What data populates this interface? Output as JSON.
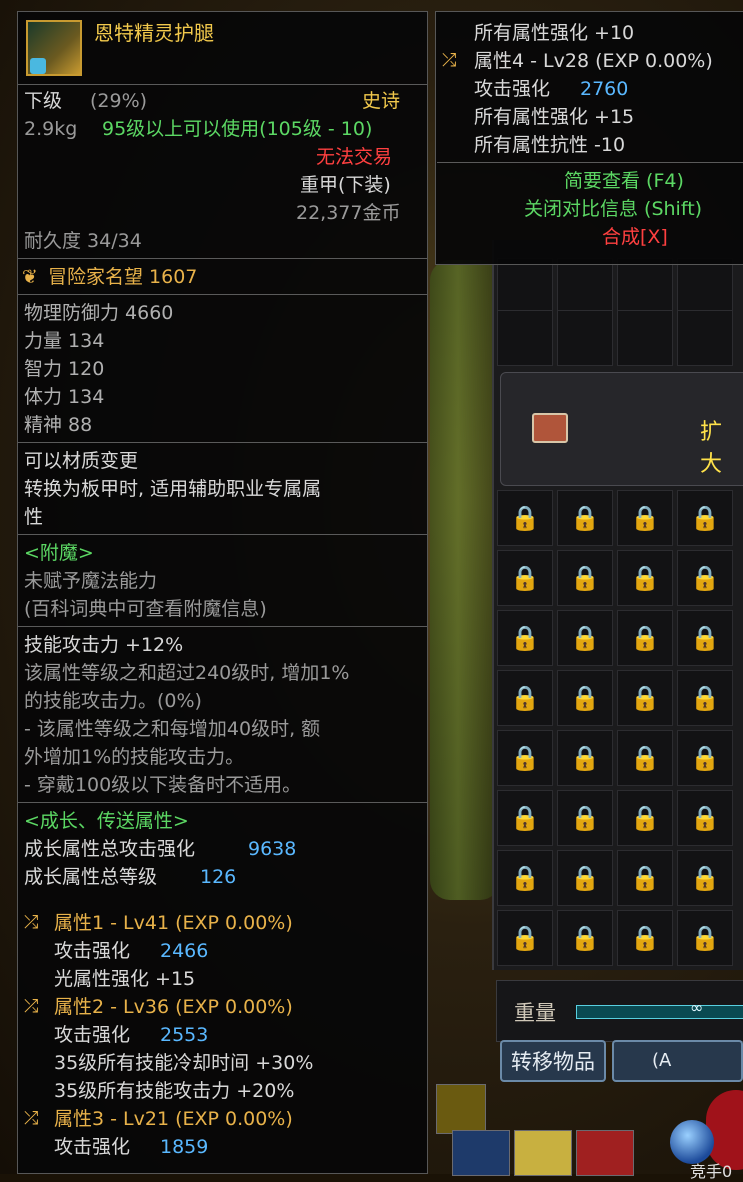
{
  "compare_tooltip": {
    "lines": [
      {
        "text": "所有属性强化 +10",
        "color": "w"
      },
      {
        "prefix_icon": "shuffle-icon",
        "text": "属性4 - Lv28 (EXP 0.00%)",
        "color": "w"
      },
      {
        "label": "攻击强化",
        "value": "2760"
      },
      {
        "text": "所有属性强化 +15",
        "color": "w"
      },
      {
        "text": "所有属性抗性 -10",
        "color": "w"
      }
    ],
    "brief_view": "简要查看 (F4)",
    "close_compare": "关闭对比信息 (Shift)",
    "synthesize": "合成[X]"
  },
  "item": {
    "name": "恩特精灵护腿",
    "grade": "下级",
    "grade_pct": "(29%)",
    "rarity": "史诗",
    "weight": "2.9kg",
    "level_req": "95级以上可以使用(105级 - 10)",
    "trade": "无法交易",
    "slot": "重甲(下装)",
    "price": "22,377金币",
    "durability": "耐久度 34/34",
    "fame": "冒险家名望 1607",
    "stats": [
      "物理防御力 4660",
      "力量 134",
      "智力 120",
      "体力 134",
      "精神 88"
    ],
    "material_change": "可以材质变更",
    "material_desc_1": "转换为板甲时, 适用辅助职业专属属",
    "material_desc_2": "性",
    "enchant_header": "<附魔>",
    "enchant_none": "未赋予魔法能力",
    "enchant_hint": "(百科词典中可查看附魔信息)",
    "skill_atk": "技能攻击力 +12%",
    "skill_desc": [
      "该属性等级之和超过240级时, 增加1%",
      "的技能攻击力。(0%)",
      "- 该属性等级之和每增加40级时, 额",
      "外增加1%的技能攻击力。",
      "- 穿戴100级以下装备时不适用。"
    ],
    "growth_header": "<成长、传送属性>",
    "growth_total_atk_label": "成长属性总攻击强化",
    "growth_total_atk_value": "9638",
    "growth_total_lv_label": "成长属性总等级",
    "growth_total_lv_value": "126",
    "attributes": [
      {
        "title": "属性1 - Lv41 (EXP 0.00%)",
        "atk_label": "攻击强化",
        "atk_value": "2466",
        "extra": [
          "光属性强化 +15"
        ]
      },
      {
        "title": "属性2 - Lv36 (EXP 0.00%)",
        "atk_label": "攻击强化",
        "atk_value": "2553",
        "extra": [
          "35级所有技能冷却时间 +30%",
          "35级所有技能攻击力 +20%"
        ]
      },
      {
        "title": "属性3 - Lv21 (EXP 0.00%)",
        "atk_label": "攻击强化",
        "atk_value": "1859",
        "extra": []
      }
    ]
  },
  "inventory": {
    "expand_label": "扩大",
    "weight_label": "重量",
    "weight_value": "∞",
    "transfer_button": "转移物品",
    "sort_button": "(A",
    "bottom_text": "竞手0"
  },
  "colors": {
    "rarity_epic": "#f2c94c",
    "level_req": "#5cd864",
    "untradeable": "#ff4040",
    "value_blue": "#5ab8ff",
    "header_green": "#5cd864",
    "attr_orange": "#e8b24a"
  }
}
